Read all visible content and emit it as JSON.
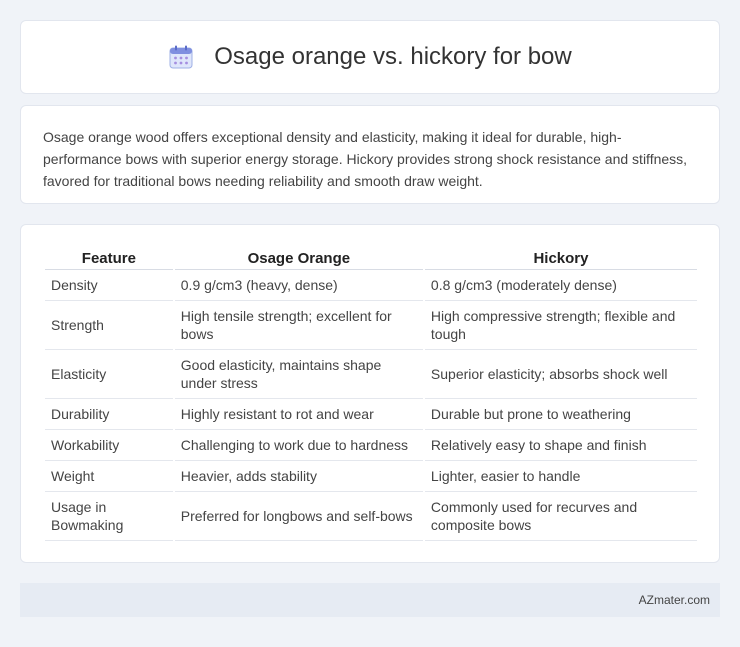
{
  "header": {
    "title": "Osage orange vs. hickory for bow",
    "icon": "calendar-icon"
  },
  "summary": {
    "text": "Osage orange wood offers exceptional density and elasticity, making it ideal for durable, high-performance bows with superior energy storage. Hickory provides strong shock resistance and stiffness, favored for traditional bows needing reliability and smooth draw weight."
  },
  "table": {
    "headers": [
      "Feature",
      "Osage Orange",
      "Hickory"
    ],
    "rows": [
      [
        "Density",
        "0.9 g/cm3 (heavy, dense)",
        "0.8 g/cm3 (moderately dense)"
      ],
      [
        "Strength",
        "High tensile strength; excellent for bows",
        "High compressive strength; flexible and tough"
      ],
      [
        "Elasticity",
        "Good elasticity, maintains shape under stress",
        "Superior elasticity; absorbs shock well"
      ],
      [
        "Durability",
        "Highly resistant to rot and wear",
        "Durable but prone to weathering"
      ],
      [
        "Workability",
        "Challenging to work due to hardness",
        "Relatively easy to shape and finish"
      ],
      [
        "Weight",
        "Heavier, adds stability",
        "Lighter, easier to handle"
      ],
      [
        "Usage in Bowmaking",
        "Preferred for longbows and self-bows",
        "Commonly used for recurves and composite bows"
      ]
    ]
  },
  "footer": {
    "brand": "AZmater.com"
  },
  "colors": {
    "background": "#f0f3f8",
    "card": "#ffffff",
    "footer": "#e6ebf3"
  }
}
